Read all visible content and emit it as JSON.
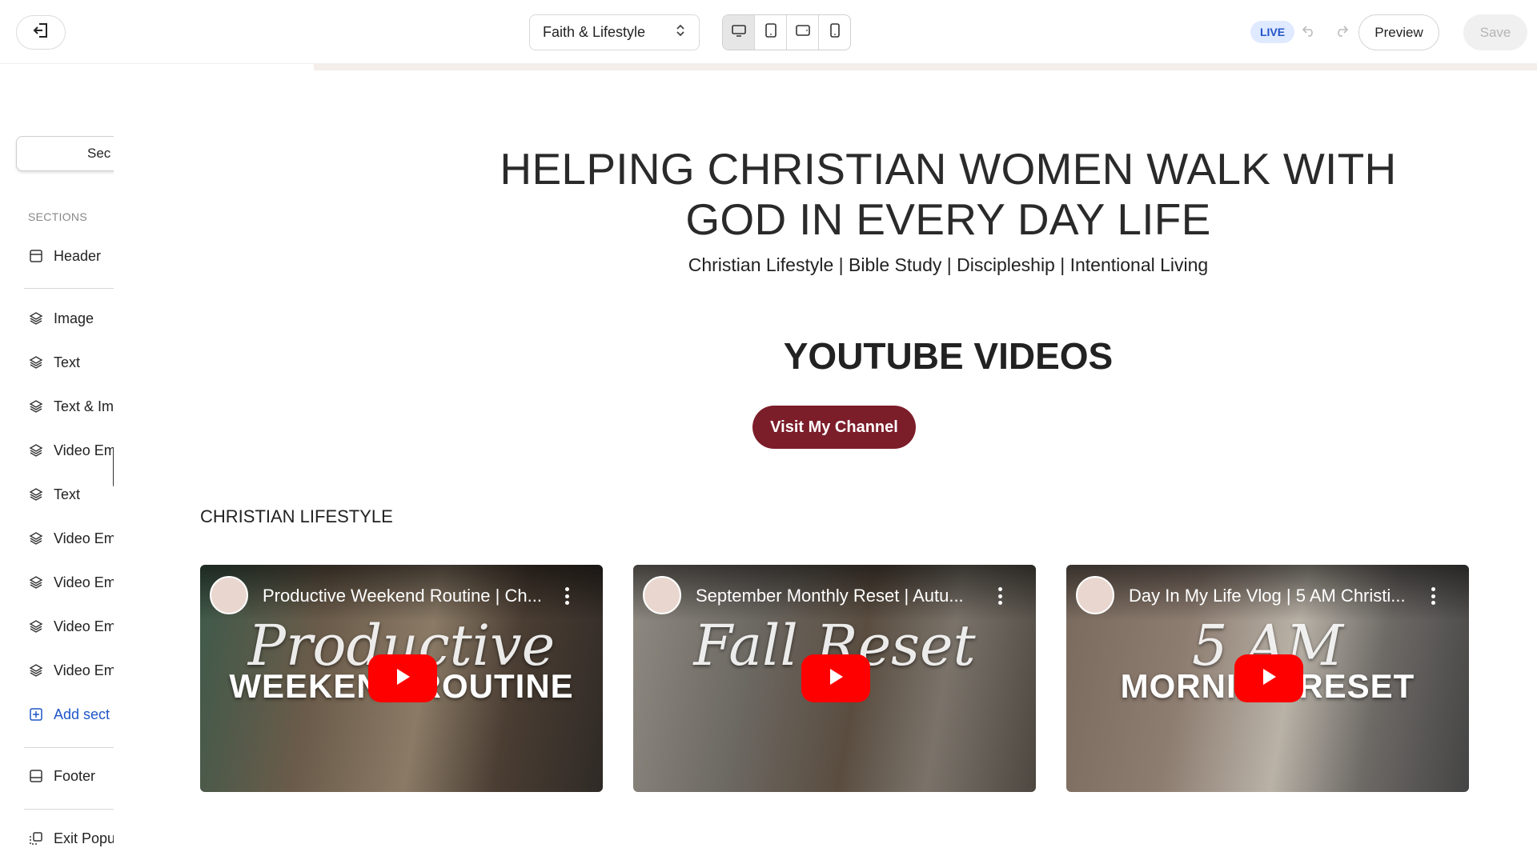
{
  "topbar": {
    "site_name": "Faith & Lifestyle",
    "live_label": "LIVE",
    "preview_label": "Preview",
    "save_label": "Save"
  },
  "sidebar": {
    "search_text": "Sec",
    "sections_label": "SECTIONS",
    "items": [
      {
        "label": "Header",
        "icon": "header-icon"
      },
      {
        "label": "Image",
        "icon": "layers-icon"
      },
      {
        "label": "Text",
        "icon": "layers-icon"
      },
      {
        "label": "Text & Im",
        "icon": "layers-icon"
      },
      {
        "label": "Video Em",
        "icon": "layers-icon"
      },
      {
        "label": "Text",
        "icon": "layers-icon"
      },
      {
        "label": "Video Em",
        "icon": "layers-icon"
      },
      {
        "label": "Video Em",
        "icon": "layers-icon"
      },
      {
        "label": "Video Em",
        "icon": "layers-icon"
      },
      {
        "label": "Video Em",
        "icon": "layers-icon"
      },
      {
        "label": "Add sect",
        "icon": "plus-square-icon"
      },
      {
        "label": "Footer",
        "icon": "footer-icon"
      },
      {
        "label": "Exit Popu",
        "icon": "popup-icon"
      }
    ]
  },
  "canvas": {
    "hero_title_line1": "HELPING CHRISTIAN WOMEN WALK WITH",
    "hero_title_line2": "GOD IN EVERY DAY LIFE",
    "hero_subtitle": "Christian Lifestyle | Bible Study | Discipleship | Intentional Living",
    "youtube_heading": "YOUTUBE VIDEOS",
    "channel_button": "Visit My Channel",
    "category_label": "CHRISTIAN LIFESTYLE",
    "videos": [
      {
        "title": "Productive Weekend Routine | Ch...",
        "overlay_script": "Productive",
        "overlay_text": "WEEKEND ROUTINE"
      },
      {
        "title": "September Monthly Reset | Autu...",
        "overlay_script": "Fall Reset",
        "overlay_text": ""
      },
      {
        "title": "Day In My Life Vlog | 5 AM Christi...",
        "overlay_script": "5 AM",
        "overlay_text": "MORNING RESET"
      }
    ]
  },
  "colors": {
    "accent_blue": "#1f56c7",
    "live_bg": "#dfe9ff",
    "channel_button_bg": "#7c1d2a",
    "youtube_red": "#ff0000"
  }
}
